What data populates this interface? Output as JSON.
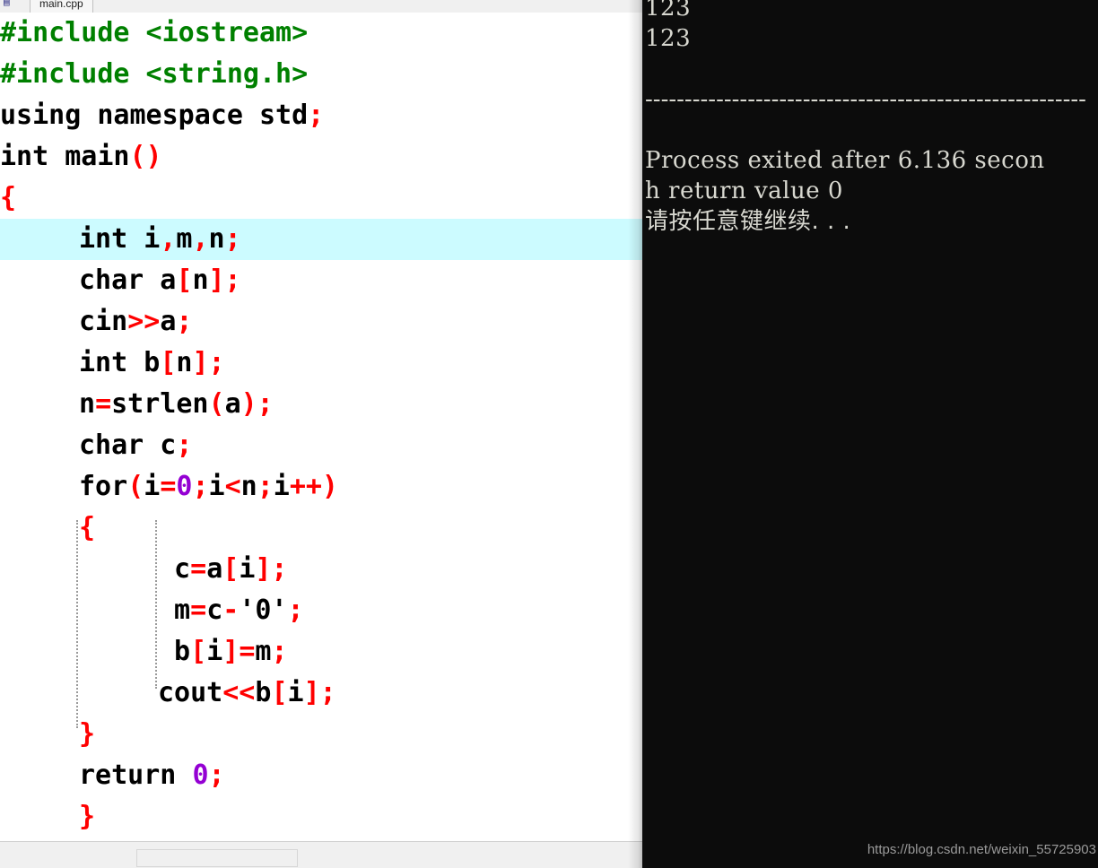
{
  "window": {
    "tab": {
      "icon": "cpp-file-icon",
      "label": "main.cpp"
    }
  },
  "editor": {
    "name": "code-editor",
    "language": "cpp",
    "highlighted_line_index": 5,
    "colors": {
      "background": "#ffffff",
      "highlight": "#ccfbff",
      "preprocessor": "#008000",
      "punctuation": "#ff0000",
      "number": "#9400d3",
      "plain": "#000000"
    },
    "lines": [
      {
        "indent": 0,
        "tokens": [
          {
            "t": "#include <iostream>",
            "c": "pre"
          }
        ]
      },
      {
        "indent": 0,
        "tokens": [
          {
            "t": "#include <string.h>",
            "c": "pre"
          }
        ]
      },
      {
        "indent": 0,
        "tokens": [
          {
            "t": "using namespace std",
            "c": "plain"
          },
          {
            "t": ";",
            "c": "punct"
          }
        ]
      },
      {
        "indent": 0,
        "tokens": [
          {
            "t": "int main",
            "c": "plain"
          },
          {
            "t": "()",
            "c": "punct"
          }
        ]
      },
      {
        "indent": 0,
        "tokens": [
          {
            "t": "{",
            "c": "punct"
          }
        ]
      },
      {
        "indent": 1,
        "tokens": [
          {
            "t": "int i",
            "c": "plain"
          },
          {
            "t": ",",
            "c": "punct"
          },
          {
            "t": "m",
            "c": "plain"
          },
          {
            "t": ",",
            "c": "punct"
          },
          {
            "t": "n",
            "c": "plain"
          },
          {
            "t": ";",
            "c": "punct"
          }
        ]
      },
      {
        "indent": 1,
        "tokens": [
          {
            "t": "char a",
            "c": "plain"
          },
          {
            "t": "[",
            "c": "punct"
          },
          {
            "t": "n",
            "c": "plain"
          },
          {
            "t": "];",
            "c": "punct"
          }
        ]
      },
      {
        "indent": 1,
        "tokens": [
          {
            "t": "cin",
            "c": "plain"
          },
          {
            "t": ">>",
            "c": "punct"
          },
          {
            "t": "a",
            "c": "plain"
          },
          {
            "t": ";",
            "c": "punct"
          }
        ]
      },
      {
        "indent": 1,
        "tokens": [
          {
            "t": "int b",
            "c": "plain"
          },
          {
            "t": "[",
            "c": "punct"
          },
          {
            "t": "n",
            "c": "plain"
          },
          {
            "t": "];",
            "c": "punct"
          }
        ]
      },
      {
        "indent": 1,
        "tokens": [
          {
            "t": "n",
            "c": "plain"
          },
          {
            "t": "=",
            "c": "punct"
          },
          {
            "t": "strlen",
            "c": "plain"
          },
          {
            "t": "(",
            "c": "punct"
          },
          {
            "t": "a",
            "c": "plain"
          },
          {
            "t": ");",
            "c": "punct"
          }
        ]
      },
      {
        "indent": 1,
        "tokens": [
          {
            "t": "char c",
            "c": "plain"
          },
          {
            "t": ";",
            "c": "punct"
          }
        ]
      },
      {
        "indent": 1,
        "tokens": [
          {
            "t": "for",
            "c": "plain"
          },
          {
            "t": "(",
            "c": "punct"
          },
          {
            "t": "i",
            "c": "plain"
          },
          {
            "t": "=",
            "c": "punct"
          },
          {
            "t": "0",
            "c": "num"
          },
          {
            "t": ";",
            "c": "punct"
          },
          {
            "t": "i",
            "c": "plain"
          },
          {
            "t": "<",
            "c": "punct"
          },
          {
            "t": "n",
            "c": "plain"
          },
          {
            "t": ";",
            "c": "punct"
          },
          {
            "t": "i",
            "c": "plain"
          },
          {
            "t": "++)",
            "c": "punct"
          }
        ]
      },
      {
        "indent": 1,
        "tokens": [
          {
            "t": "{",
            "c": "punct"
          }
        ]
      },
      {
        "indent": 2,
        "tokens": [
          {
            "t": " c",
            "c": "plain"
          },
          {
            "t": "=",
            "c": "punct"
          },
          {
            "t": "a",
            "c": "plain"
          },
          {
            "t": "[",
            "c": "punct"
          },
          {
            "t": "i",
            "c": "plain"
          },
          {
            "t": "];",
            "c": "punct"
          }
        ]
      },
      {
        "indent": 2,
        "tokens": [
          {
            "t": " m",
            "c": "plain"
          },
          {
            "t": "=",
            "c": "punct"
          },
          {
            "t": "c",
            "c": "plain"
          },
          {
            "t": "-",
            "c": "punct"
          },
          {
            "t": "'0'",
            "c": "plain"
          },
          {
            "t": ";",
            "c": "punct"
          }
        ]
      },
      {
        "indent": 2,
        "tokens": [
          {
            "t": " b",
            "c": "plain"
          },
          {
            "t": "[",
            "c": "punct"
          },
          {
            "t": "i",
            "c": "plain"
          },
          {
            "t": "]",
            "c": "punct"
          },
          {
            "t": "=",
            "c": "punct"
          },
          {
            "t": "m",
            "c": "plain"
          },
          {
            "t": ";",
            "c": "punct"
          }
        ]
      },
      {
        "indent": 2,
        "tokens": [
          {
            "t": "cout",
            "c": "plain"
          },
          {
            "t": "<<",
            "c": "punct"
          },
          {
            "t": "b",
            "c": "plain"
          },
          {
            "t": "[",
            "c": "punct"
          },
          {
            "t": "i",
            "c": "plain"
          },
          {
            "t": "];",
            "c": "punct"
          }
        ]
      },
      {
        "indent": 1,
        "tokens": [
          {
            "t": "}",
            "c": "punct"
          }
        ]
      },
      {
        "indent": 1,
        "tokens": [
          {
            "t": "return ",
            "c": "plain"
          },
          {
            "t": "0",
            "c": "num"
          },
          {
            "t": ";",
            "c": "punct"
          }
        ]
      },
      {
        "indent": 1,
        "tokens": [
          {
            "t": "}",
            "c": "punct"
          }
        ]
      }
    ]
  },
  "statusbar": {
    "panel_text": ""
  },
  "console": {
    "name": "program-output-console",
    "background": "#0c0c0c",
    "text_color": "#d8d8d0",
    "lines": [
      "123",
      "123",
      "",
      "--------------------------------------------------------",
      "",
      "Process exited after 6.136 secon",
      "h return value 0",
      "请按任意键继续. . ."
    ]
  },
  "watermark": {
    "text": "https://blog.csdn.net/weixin_55725903"
  }
}
